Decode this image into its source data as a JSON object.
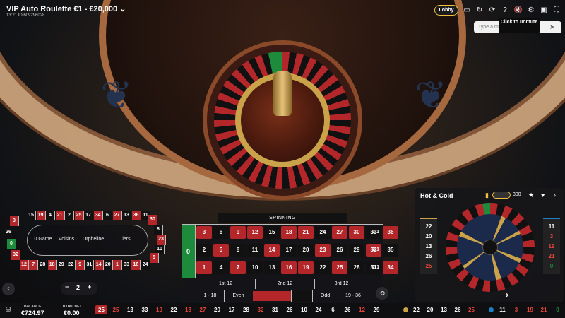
{
  "header": {
    "title": "VIP Auto Roulette €1 - €20,000",
    "subtitle": "13:21 ID:609296028",
    "lobby_label": "Lobby",
    "icons": [
      "chat-icon",
      "history-icon",
      "refresh-icon",
      "help-icon",
      "sound-icon",
      "settings-icon",
      "camera-icon",
      "fullscreen-icon"
    ]
  },
  "chat": {
    "placeholder": "Type a m",
    "tooltip": "Click to unmute"
  },
  "racetrack": {
    "top_row": [
      "15",
      "19",
      "4",
      "21",
      "2",
      "25",
      "17",
      "34",
      "6",
      "27",
      "13",
      "36",
      "11"
    ],
    "bottom_row": [
      "12",
      "7",
      "28",
      "18",
      "29",
      "22",
      "9",
      "31",
      "14",
      "20",
      "1",
      "33",
      "16",
      "24"
    ],
    "left": [
      "3",
      "26",
      "0",
      "32"
    ],
    "right": [
      "30",
      "8",
      "23",
      "10",
      "5"
    ],
    "sections": [
      "0 Game",
      "Voisins",
      "Orpheline",
      "Tiers"
    ]
  },
  "status": "SPINNING",
  "grid": {
    "zero": "0",
    "rows": [
      [
        "3",
        "6",
        "9",
        "12",
        "15",
        "18",
        "21",
        "24",
        "27",
        "30",
        "33",
        "36"
      ],
      [
        "2",
        "5",
        "8",
        "11",
        "14",
        "17",
        "20",
        "23",
        "26",
        "29",
        "32",
        "35"
      ],
      [
        "1",
        "4",
        "7",
        "10",
        "13",
        "16",
        "19",
        "22",
        "25",
        "28",
        "31",
        "34"
      ]
    ],
    "red": [
      "1",
      "3",
      "5",
      "7",
      "9",
      "12",
      "14",
      "16",
      "18",
      "19",
      "21",
      "23",
      "25",
      "27",
      "30",
      "32",
      "34",
      "36"
    ],
    "column_label": "2:1",
    "dozens": [
      "1st 12",
      "2nd 12",
      "3rd 12"
    ],
    "outside": [
      "1 - 18",
      "Even",
      "",
      "",
      "Odd",
      "19 - 36"
    ]
  },
  "chip_stepper": {
    "minus": "−",
    "value": "2",
    "plus": "+"
  },
  "balance": {
    "label": "BALANCE",
    "value": "€724.97",
    "bet_label": "TOTAL BET",
    "bet_value": "€0.00"
  },
  "history": [
    "25",
    "25",
    "13",
    "33",
    "19",
    "22",
    "18",
    "27",
    "20",
    "17",
    "28",
    "32",
    "31",
    "26",
    "10",
    "24",
    "6",
    "26",
    "12",
    "29"
  ],
  "hot_cold": {
    "title": "Hot & Cold",
    "count": "300",
    "hot": [
      "22",
      "20",
      "13",
      "26",
      "25"
    ],
    "cold": [
      "11",
      "3",
      "19",
      "21",
      "0"
    ],
    "hot_color": "#c9a24a",
    "cold_color": "#1b7fc4"
  },
  "history_right": [
    "22",
    "20",
    "13",
    "26",
    "25",
    "11",
    "3",
    "19",
    "21",
    "0"
  ],
  "colors": {
    "red": "#b3262a",
    "black": "#111111",
    "green": "#1e8a3c",
    "gold": "#f0c040"
  }
}
